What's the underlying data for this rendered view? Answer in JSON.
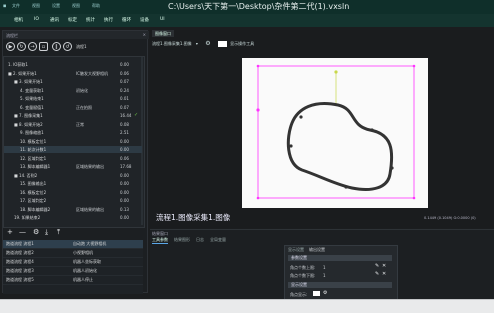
{
  "titlebar": {
    "menus": [
      "文件",
      "视图",
      "设置",
      "视图",
      "帮助"
    ],
    "title": "C:\\Users\\天下第一\\Desktop\\杂件第二代(1).vxsln"
  },
  "menubar": {
    "items": [
      "相机",
      "IO",
      "通讯",
      "标定",
      "统计",
      "执行",
      "循环",
      "设备",
      "UI"
    ]
  },
  "left_panel": {
    "header": "流程栏",
    "close": "×",
    "flow_name": "流程1",
    "tree": [
      {
        "indent": 0,
        "name": "1. IO获取1",
        "c2": "",
        "c3": "0.00",
        "ok": false,
        "sel": false
      },
      {
        "indent": 0,
        "name": "■ 2. 如果开始1",
        "c2": "IC触发大视野相机",
        "c3": "0.06",
        "ok": false,
        "sel": false
      },
      {
        "indent": 1,
        "name": "■ 3. 如果开始1",
        "c2": "",
        "c3": "0.07",
        "ok": false,
        "sel": false
      },
      {
        "indent": 2,
        "name": "4. 变量获取1",
        "c2": "初始化",
        "c3": "0.24",
        "ok": false,
        "sel": false
      },
      {
        "indent": 2,
        "name": "5. 如果结束1",
        "c2": "",
        "c3": "0.01",
        "ok": false,
        "sel": false
      },
      {
        "indent": 2,
        "name": "6. 变量赋值1",
        "c2": "正在拍照",
        "c3": "0.07",
        "ok": false,
        "sel": false
      },
      {
        "indent": 1,
        "name": "■ 7. 图像采集1",
        "c2": "",
        "c3": "16.44",
        "ok": true,
        "sel": false
      },
      {
        "indent": 1,
        "name": "■ 8. 如果开始2",
        "c2": "正常",
        "c3": "0.08",
        "ok": false,
        "sel": false
      },
      {
        "indent": 2,
        "name": "9. 图像缩放1",
        "c2": "",
        "c3": "2.51",
        "ok": false,
        "sel": false
      },
      {
        "indent": 2,
        "name": "10. 模板定位1",
        "c2": "",
        "c3": "0.00",
        "ok": false,
        "sel": false
      },
      {
        "indent": 2,
        "name": "11. 轮次计数1",
        "c2": "",
        "c3": "0.00",
        "ok": false,
        "sel": true
      },
      {
        "indent": 2,
        "name": "12. 区域判定1",
        "c2": "",
        "c3": "0.06",
        "ok": false,
        "sel": false
      },
      {
        "indent": 2,
        "name": "13. 脚本编辑器1",
        "c2": "区域结果的输出",
        "c3": "17.68",
        "ok": false,
        "sel": false
      },
      {
        "indent": 1,
        "name": "■ 14. 否则2",
        "c2": "",
        "c3": "0.00",
        "ok": false,
        "sel": false
      },
      {
        "indent": 2,
        "name": "15. 图像输出1",
        "c2": "",
        "c3": "0.00",
        "ok": false,
        "sel": false
      },
      {
        "indent": 2,
        "name": "16. 模板定位2",
        "c2": "",
        "c3": "0.00",
        "ok": false,
        "sel": false
      },
      {
        "indent": 2,
        "name": "17. 区域判定2",
        "c2": "",
        "c3": "0.00",
        "ok": false,
        "sel": false
      },
      {
        "indent": 2,
        "name": "18. 脚本编辑器2",
        "c2": "区域结果的输出",
        "c3": "0.13",
        "ok": false,
        "sel": false
      },
      {
        "indent": 1,
        "name": "19. 如果结束2",
        "c2": "",
        "c3": "0.00",
        "ok": false,
        "sel": false
      }
    ],
    "bottom_tools": [
      "+",
      "—",
      "⚙",
      "⤓",
      "⤒"
    ],
    "flows": [
      {
        "a": "跑道流程 流程1",
        "b": "自动跑 大视野相机",
        "sel": true
      },
      {
        "a": "跑道流程 流程2",
        "b": "小视野相机",
        "sel": false
      },
      {
        "a": "跑道流程 流程4",
        "b": "机器人坐标获取",
        "sel": false
      },
      {
        "a": "跑道流程 流程3",
        "b": "机器人初始化",
        "sel": false
      },
      {
        "a": "跑道流程 流程5",
        "b": "机器人停止",
        "sel": false
      }
    ]
  },
  "image_panel": {
    "tab": "图像窗口",
    "source": "流程1.图像采集1.图像",
    "checkbox_label": "显示操作工具",
    "caption": "流程1.图像采集1.图像",
    "coords": "0.1449 (0.1049) G:0.0000 (0)"
  },
  "result_panel": {
    "header": "结果窗口",
    "tabs": [
      "工具参数",
      "结果图形",
      "日志",
      "全局变量"
    ],
    "prop_tabs": [
      "显示设置",
      "输出设置"
    ],
    "section1": "参数设置",
    "row1": {
      "label": "角点个数上限:",
      "value": "1"
    },
    "row2": {
      "label": "角点个数下限:",
      "value": "1"
    },
    "section2": "显示设置",
    "row3": {
      "label": "角点显示:"
    }
  },
  "colors": {
    "accent": "#ff33ff",
    "ok": "#6cc04a",
    "title_bg": "#0f2f2a"
  }
}
